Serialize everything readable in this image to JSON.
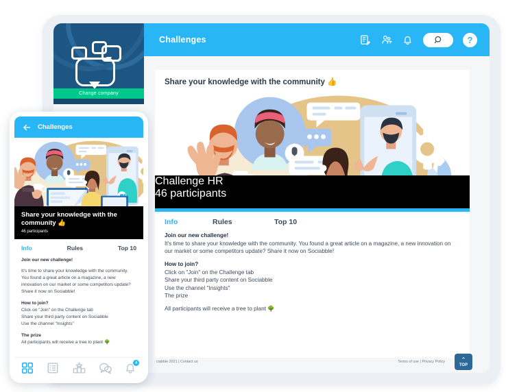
{
  "colors": {
    "brand_blue": "#29b6f6",
    "sidebar_dark": "#1d5583",
    "green_button": "#00c78a",
    "band_black": "#000000",
    "rail_blue": "#2e6896",
    "page_bg": "#ffffff"
  },
  "tablet": {
    "sidebar": {
      "logo_name": "speech-bubble-logo",
      "change_company_label": "Change company"
    },
    "header": {
      "title": "Challenges",
      "icons": [
        "compose-post-icon",
        "add-people-icon",
        "bell-icon"
      ],
      "search_label": "search-icon",
      "help_label": "?"
    },
    "right_rail": {
      "list_tab": "list-icon",
      "collapse_label": "‹"
    },
    "card": {
      "title": "Share your knowledge with the community 👍",
      "illustration_name": "community-video-call-illustration",
      "band": {
        "title": "Challenge HR",
        "participants": "46 participants"
      },
      "tabs": [
        {
          "label": "Info",
          "active": true
        },
        {
          "label": "Rules",
          "active": false
        },
        {
          "label": "Top 10",
          "active": false
        }
      ],
      "sections": {
        "join_heading": "Join our new challenge!",
        "join_text": "It's time to share your knowledge with the community. You found a great article on a magazine, a new innovation on our market or some competitors update? Share it now on Sociabble!",
        "how_heading": "How to join?",
        "how_line1": "Click on \"Join\" on the Challenge tab",
        "how_line2": "Share your third party content on Sociabble",
        "how_line3": "Use the channel \"Insights\"",
        "how_line4": "The prize",
        "prize_text": "All participants will receive a tree to plant 🌳"
      }
    },
    "footer": {
      "left": "ciabble 2021  |  Contact us",
      "right": "Terms of use | Privacy Policy",
      "top_button": "TOP",
      "top_caret": "⌃"
    }
  },
  "phone": {
    "header": {
      "back_icon": "arrow-left-icon",
      "title": "Challenges"
    },
    "illustration_name": "community-video-call-illustration",
    "band": {
      "title": "Share your knowledge with the community 👍",
      "participants": "46 participants"
    },
    "tabs": [
      {
        "label": "Info",
        "active": true
      },
      {
        "label": "Rules",
        "active": false
      },
      {
        "label": "Top 10",
        "active": false
      }
    ],
    "sections": {
      "join_heading": "Join our new challenge!",
      "join_text": "It's time to share your knowledge with the community. You found a great article on a magazine, a new innovation on our market or some competitors update? Share it now on Sociabble!",
      "how_heading": "How to join?",
      "how_line1": "Click on \"Join\" on the Challenge tab",
      "how_line2": "Share your third party content on Sociabble",
      "how_line3": "Use the channel \"Insights\"",
      "prize_heading": "The prize",
      "prize_text": "All participants will receive a tree to plant 🌳"
    },
    "nav": {
      "items": [
        "grid-icon",
        "list-icon",
        "leaderboard-icon",
        "chat-icon",
        "bell-icon"
      ],
      "badge_count": "4"
    }
  }
}
